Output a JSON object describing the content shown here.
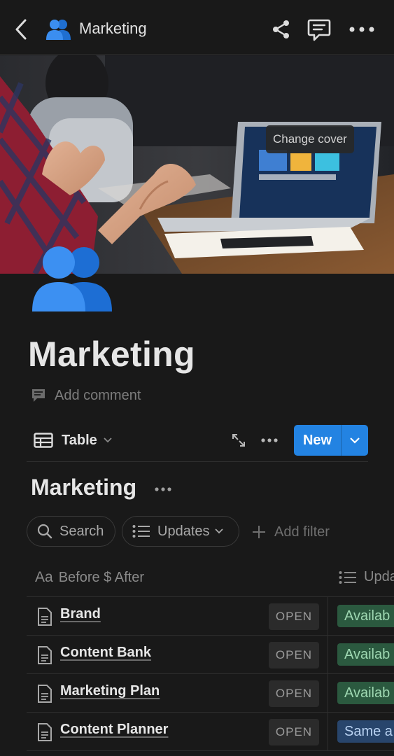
{
  "topbar": {
    "title": "Marketing",
    "icon": "people-emoji-icon",
    "back_icon": "chevron-left-icon",
    "share_icon": "share-icon",
    "comment_icon": "comment-icon",
    "more_icon": "ellipsis-icon"
  },
  "cover": {
    "change_cover_label": "Change cover"
  },
  "page": {
    "title": "Marketing",
    "add_comment_label": "Add comment"
  },
  "view_bar": {
    "view_label": "Table",
    "new_label": "New"
  },
  "database": {
    "title": "Marketing"
  },
  "filters": {
    "search_label": "Search",
    "updates_label": "Updates",
    "add_filter_label": "Add filter"
  },
  "table": {
    "columns": {
      "name_prefix": "Aa",
      "name": "Before $ After",
      "updates": "Upda"
    },
    "rows": [
      {
        "name": "Brand",
        "open": "OPEN",
        "tag": "Availab",
        "tag_color": "#2b593f",
        "tag_text": "#9fd8b2"
      },
      {
        "name": "Content Bank",
        "open": "OPEN",
        "tag": "Availab",
        "tag_color": "#2b593f",
        "tag_text": "#9fd8b2"
      },
      {
        "name": "Marketing Plan",
        "open": "OPEN",
        "tag": "Availab",
        "tag_color": "#2b593f",
        "tag_text": "#9fd8b2"
      },
      {
        "name": "Content Planner",
        "open": "OPEN",
        "tag": "Same a",
        "tag_color": "#28456c",
        "tag_text": "#b9d2f2"
      }
    ]
  },
  "colors": {
    "background": "#191919",
    "accent": "#2383e2"
  }
}
